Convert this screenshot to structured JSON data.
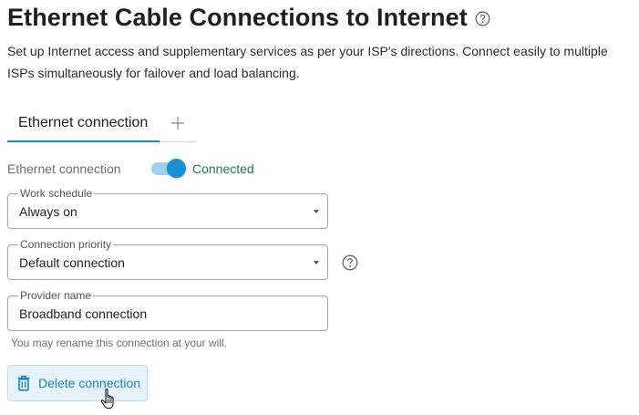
{
  "header": {
    "title": "Ethernet Cable Connections to Internet",
    "help_icon": "question-circle-icon"
  },
  "description": "Set up Internet access and supplementary services as per your ISP's directions. Connect easily to multiple ISPs simultaneously for failover and load balancing.",
  "tabs": {
    "items": [
      {
        "label": "Ethernet connection",
        "active": true
      }
    ],
    "add_icon": "plus-icon"
  },
  "ethernet_toggle": {
    "label": "Ethernet connection",
    "state": "on",
    "status": "Connected"
  },
  "work_schedule": {
    "legend": "Work schedule",
    "value": "Always on"
  },
  "connection_priority": {
    "legend": "Connection priority",
    "value": "Default connection",
    "help_icon": "question-circle-icon"
  },
  "provider_name": {
    "legend": "Provider name",
    "value": "Broadband connection",
    "hint": "You may rename this connection at your will."
  },
  "delete_button": {
    "label": "Delete connection",
    "icon": "trash-icon"
  },
  "colors": {
    "accent": "#1b88c8",
    "status_connected": "#1e7d45",
    "button_bg": "#e6f3fb"
  }
}
